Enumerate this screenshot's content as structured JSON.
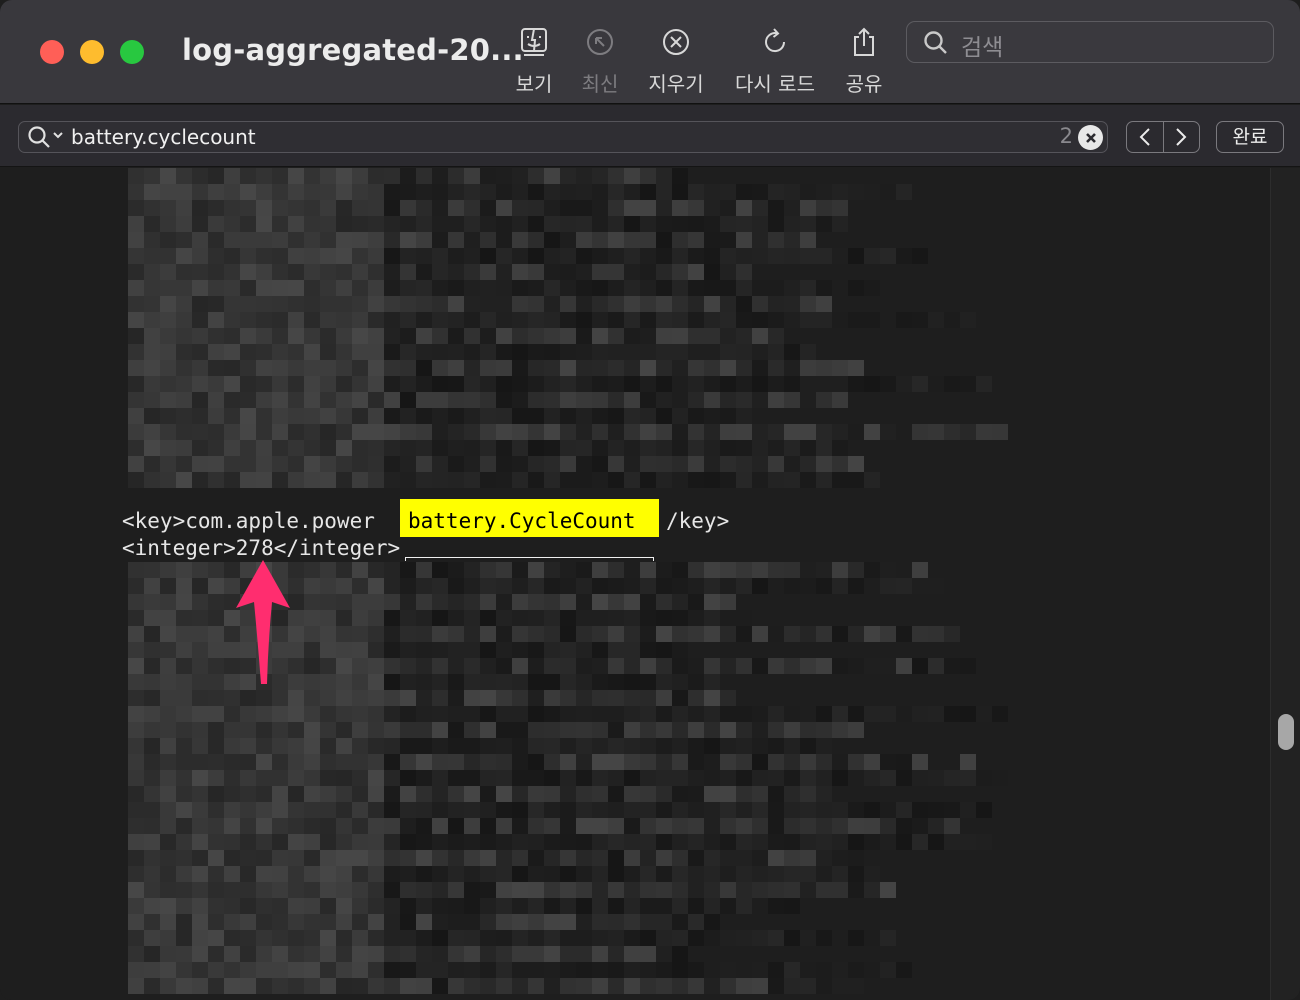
{
  "window": {
    "title": "log-aggregated-20..."
  },
  "toolbar": {
    "items": [
      {
        "label": "보기",
        "icon": "finder-view-icon",
        "enabled": true
      },
      {
        "label": "최신",
        "icon": "jump-to-latest-icon",
        "enabled": false
      },
      {
        "label": "지우기",
        "icon": "clear-circle-x-icon",
        "enabled": true
      },
      {
        "label": "다시 로드",
        "icon": "reload-icon",
        "enabled": true
      },
      {
        "label": "공유",
        "icon": "share-icon",
        "enabled": true
      }
    ],
    "search_placeholder": "검색"
  },
  "findbar": {
    "query": "battery.cyclecount",
    "match_count": "2",
    "done_label": "완료"
  },
  "content": {
    "line1_prefix": "<key>com.apple.power",
    "line1_highlight": "battery.CycleCount",
    "line1_suffix": "/key>",
    "line2": "<integer>278</integer>"
  },
  "colors": {
    "highlight": "#ffff00",
    "annotation_arrow": "#ff2d6f",
    "titlebar": "#39383d",
    "background": "#1e1e1e"
  }
}
